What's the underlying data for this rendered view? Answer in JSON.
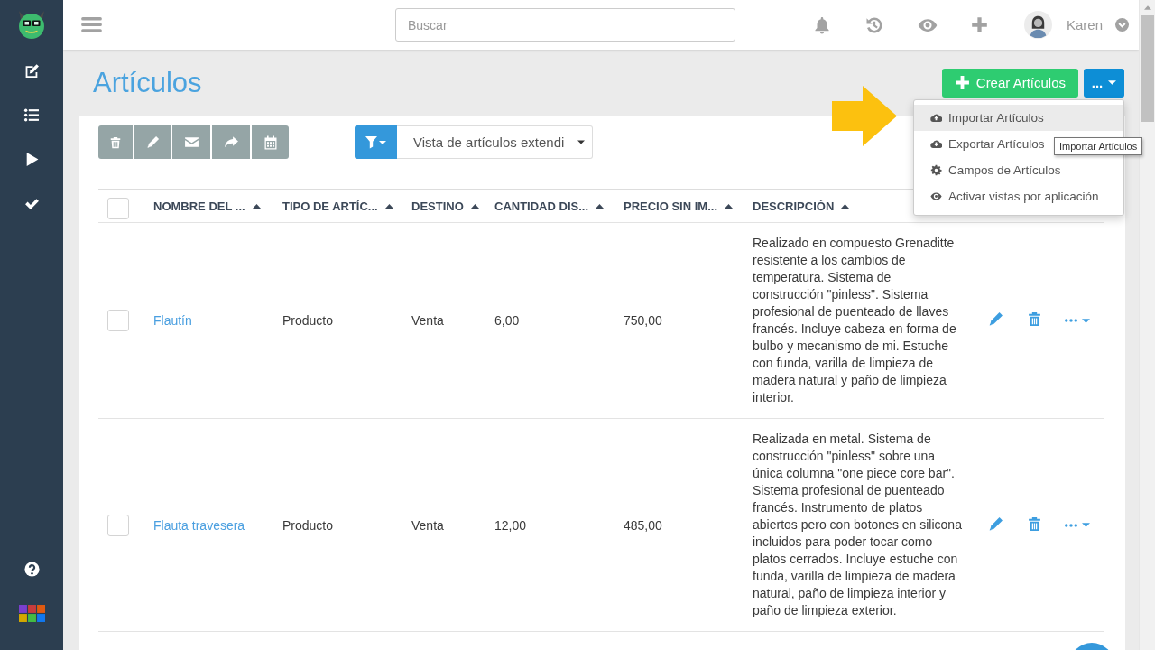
{
  "header": {
    "search": {
      "placeholder": "Buscar"
    },
    "user": {
      "name": "Karen"
    }
  },
  "page": {
    "title": "Artículos",
    "create_button": {
      "label": "Crear Artículos"
    },
    "more_button": {
      "label": "..."
    }
  },
  "more_menu": {
    "items": [
      {
        "label": "Importar Artículos",
        "highlighted": true
      },
      {
        "label": "Exportar Artículos",
        "highlighted": false
      },
      {
        "label": "Campos de Artículos",
        "highlighted": false
      },
      {
        "label": "Activar vistas por aplicación",
        "highlighted": false
      }
    ]
  },
  "tooltip": {
    "text": "Importar Artículos"
  },
  "view_select": {
    "value": "Vista de artículos extendi"
  },
  "table": {
    "select_all": {
      "checked": false
    },
    "columns": [
      {
        "label": "NOMBRE DEL ...",
        "sorted": true
      },
      {
        "label": "TIPO DE ARTÍC...",
        "sorted": true
      },
      {
        "label": "DESTINO",
        "sorted": true
      },
      {
        "label": "CANTIDAD DIS...",
        "sorted": true
      },
      {
        "label": "PRECIO SIN IM...",
        "sorted": true
      },
      {
        "label": "DESCRIPCIÓN",
        "sorted": true
      }
    ],
    "rows": [
      {
        "checked": false,
        "name": "Flautín",
        "type": "Producto",
        "destination": "Venta",
        "quantity": "6,00",
        "price": "750,00",
        "description": "Realizado en compuesto Grenaditte resistente a los cambios de temperatura. Sistema de construcción \"pinless\". Sistema profesional de puenteado de llaves francés. Incluye cabeza en forma de bulbo y mecanismo de mi. Estuche con funda, varilla de limpieza de madera natural y paño de limpieza interior."
      },
      {
        "checked": false,
        "name": "Flauta travesera",
        "type": "Producto",
        "destination": "Venta",
        "quantity": "12,00",
        "price": "485,00",
        "description": "Realizada en metal. Sistema de construcción \"pinless\" sobre una única columna \"one piece core bar\". Sistema profesional de puenteado francés. Instrumento de platos abiertos pero con botones en silicona incluidos para poder tocar como platos cerrados. Incluye estuche con funda, varilla de limpieza de madera natural, paño de limpieza interior y paño de limpieza exterior."
      }
    ]
  }
}
